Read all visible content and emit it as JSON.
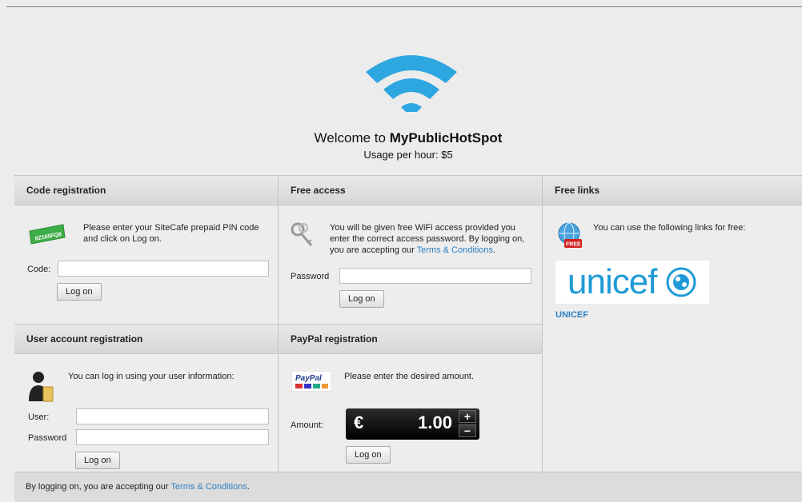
{
  "header": {
    "welcome_prefix": "Welcome to ",
    "brand": "MyPublicHotSpot",
    "usage": "Usage per hour: $5",
    "wifi_icon": "wifi-icon",
    "wifi_color": "#2ea6e0"
  },
  "code_registration": {
    "title": "Code registration",
    "icon": "pin-ticket-icon",
    "ticket_text": "8Z165FQ8",
    "description": "Please enter your SiteCafe prepaid PIN code and click on Log on.",
    "code_label": "Code:",
    "code_value": "",
    "button": "Log on"
  },
  "free_access": {
    "title": "Free access",
    "icon": "keys-icon",
    "description_prefix": "You will be given free WiFi access provided you enter the correct access password. By logging on, you are accepting our ",
    "terms_link": "Terms & Conditions",
    "description_suffix": ".",
    "password_label": "Password",
    "password_value": "",
    "button": "Log on"
  },
  "free_links": {
    "title": "Free links",
    "icon": "free-globe-icon",
    "free_badge": "FREE",
    "description": "You can use the following links for free:",
    "logo_text": "unicef",
    "link": "UNICEF"
  },
  "user_account": {
    "title": "User account registration",
    "icon": "user-icon",
    "description": "You can log in using your user information:",
    "user_label": "User:",
    "user_value": "",
    "password_label": "Password",
    "password_value": "",
    "button": "Log on"
  },
  "paypal": {
    "title": "PayPal registration",
    "icon": "paypal-icon",
    "paypal_text": "PayPal",
    "description": "Please enter the desired amount.",
    "amount_label": "Amount:",
    "currency": "€",
    "amount": "1.00",
    "plus": "+",
    "minus": "−",
    "button": "Log on"
  },
  "footer": {
    "prefix": "By logging on, you are accepting our ",
    "terms_link": "Terms & Conditions",
    "suffix": "."
  }
}
